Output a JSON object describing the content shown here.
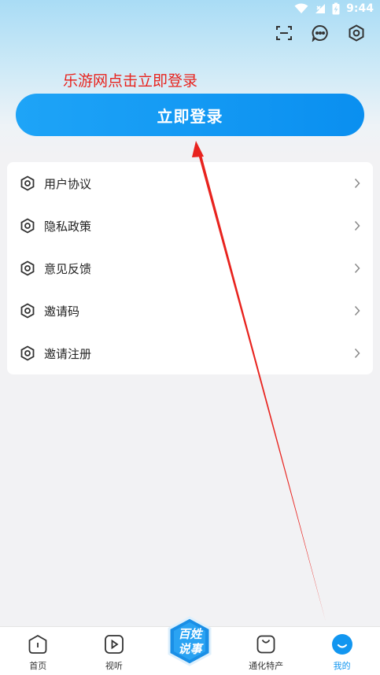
{
  "status_bar": {
    "time": "9:44"
  },
  "annotation": {
    "text": "乐游网点击立即登录"
  },
  "login": {
    "button_label": "立即登录"
  },
  "menu": {
    "items": [
      {
        "label": "用户协议"
      },
      {
        "label": "隐私政策"
      },
      {
        "label": "意见反馈"
      },
      {
        "label": "邀请码"
      },
      {
        "label": "邀请注册"
      }
    ]
  },
  "tabbar": {
    "tabs": [
      {
        "label": "首页"
      },
      {
        "label": "视听"
      },
      {
        "label": "百姓说事",
        "line1": "百姓",
        "line2": "说事"
      },
      {
        "label": "通化特产"
      },
      {
        "label": "我的"
      }
    ]
  },
  "colors": {
    "accent": "#1296f0",
    "annotation": "#e8231e",
    "background": "#f2f2f4"
  },
  "icons": {
    "top_actions": [
      "scan-icon",
      "message-icon",
      "settings-icon"
    ],
    "menu_item": "hexagon-ring-icon",
    "tabs": [
      "home-icon",
      "play-icon",
      "center-logo-icon",
      "bag-icon",
      "smile-icon"
    ]
  }
}
